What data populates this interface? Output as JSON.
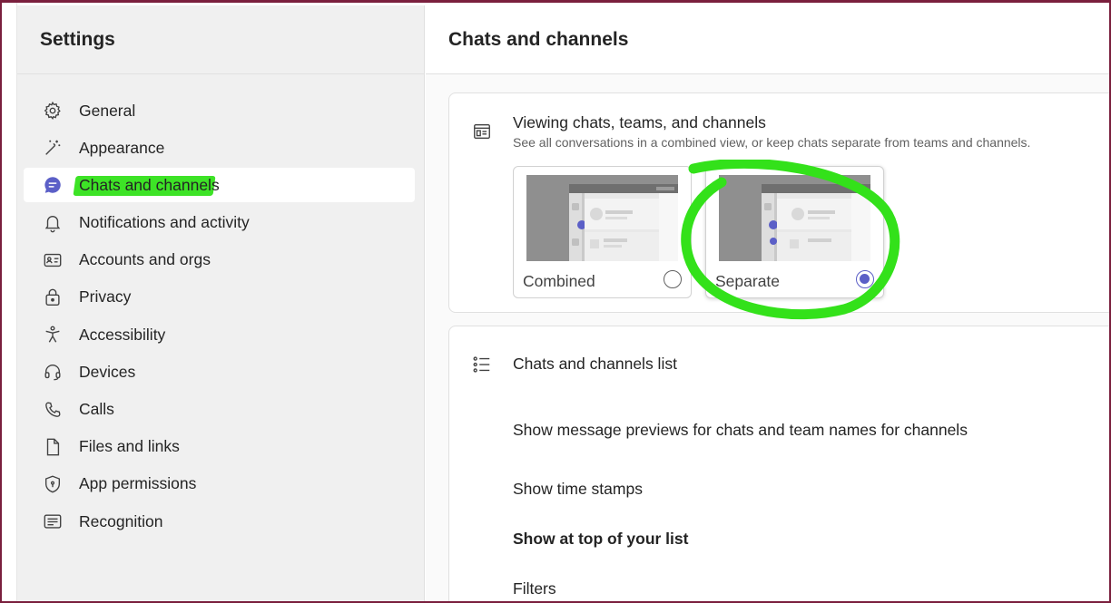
{
  "sidebar": {
    "title": "Settings",
    "items": [
      {
        "label": "General",
        "icon": "gear-icon"
      },
      {
        "label": "Appearance",
        "icon": "magic-wand-icon"
      },
      {
        "label": "Chats and channels",
        "icon": "chat-icon",
        "active": true
      },
      {
        "label": "Notifications and activity",
        "icon": "bell-icon"
      },
      {
        "label": "Accounts and orgs",
        "icon": "contact-card-icon"
      },
      {
        "label": "Privacy",
        "icon": "lock-icon"
      },
      {
        "label": "Accessibility",
        "icon": "accessibility-icon"
      },
      {
        "label": "Devices",
        "icon": "headset-icon"
      },
      {
        "label": "Calls",
        "icon": "phone-icon"
      },
      {
        "label": "Files and links",
        "icon": "document-icon"
      },
      {
        "label": "App permissions",
        "icon": "shield-icon"
      },
      {
        "label": "Recognition",
        "icon": "recognition-icon"
      }
    ]
  },
  "main": {
    "title": "Chats and channels",
    "viewing": {
      "title": "Viewing chats, teams, and channels",
      "subtitle": "See all conversations in a combined view, or keep chats separate from teams and channels.",
      "options": [
        {
          "label": "Combined",
          "selected": false
        },
        {
          "label": "Separate",
          "selected": true
        }
      ]
    },
    "list": {
      "title": "Chats and channels list",
      "show_previews": "Show message previews for chats and team names for channels",
      "show_timestamps": "Show time stamps",
      "show_at_top": "Show at top of your list",
      "filters": "Filters"
    }
  },
  "colors": {
    "accent": "#5b5fc7",
    "annotation": "#33e11a",
    "frame": "#7a1f3d"
  }
}
